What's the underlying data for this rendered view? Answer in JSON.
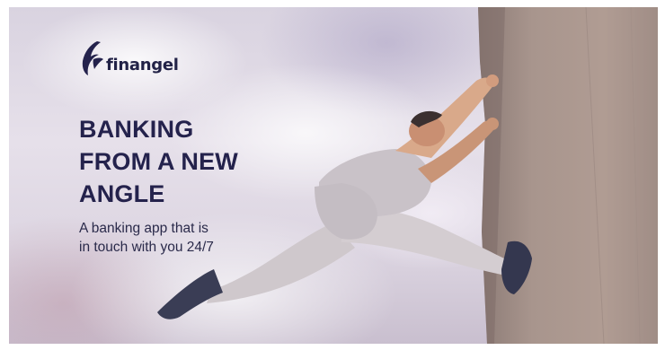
{
  "brand": {
    "name": "finangel",
    "color": "#24224c",
    "logo_icon": "angel-wing-icon"
  },
  "headline": {
    "lines": [
      "BANKING",
      "FROM A NEW",
      "ANGLE"
    ]
  },
  "subtitle": {
    "lines": [
      "A banking app that is",
      "in touch with you 24/7"
    ]
  },
  "scene": {
    "background": "sky-with-clouds",
    "subject": "man-climbing-concrete-wall",
    "wall_color": "#9c8a83"
  }
}
